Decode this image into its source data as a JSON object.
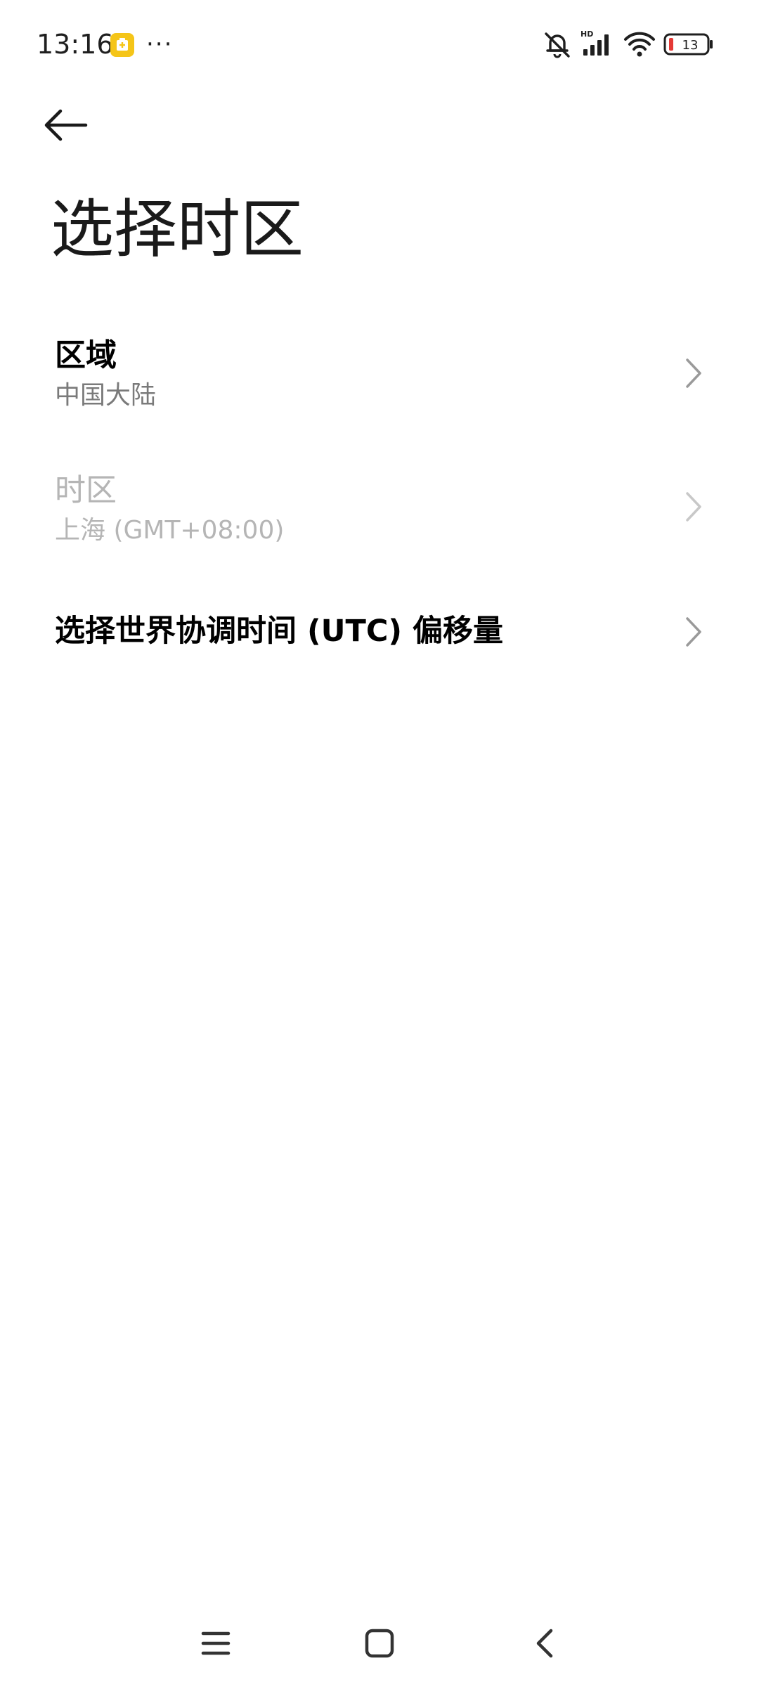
{
  "status_bar": {
    "time": "13:16",
    "overflow": "···",
    "battery_level": "13",
    "network_label": "HD",
    "icons": [
      "app-notification-icon",
      "mute-bell-icon",
      "signal-icon",
      "wifi-icon",
      "battery-icon"
    ]
  },
  "header": {
    "back_icon": "arrow-left-icon",
    "title": "选择时区"
  },
  "settings": {
    "items": [
      {
        "title": "区域",
        "subtitle": "中国大陆",
        "enabled": true
      },
      {
        "title": "时区",
        "subtitle": "上海 (GMT+08:00)",
        "enabled": false
      },
      {
        "title": "选择世界协调时间 (UTC) 偏移量",
        "enabled": true
      }
    ]
  },
  "nav_bar": {
    "buttons": [
      "menu-icon",
      "home-icon",
      "back-icon"
    ]
  },
  "colors": {
    "background": "#ffffff",
    "primary_text": "#000000",
    "secondary_text": "#7a7a7a",
    "disabled_text": "#b5b5b5",
    "chevron": "#9a9a9a",
    "notification_accent": "#f5c518",
    "battery_low": "#e53935"
  }
}
